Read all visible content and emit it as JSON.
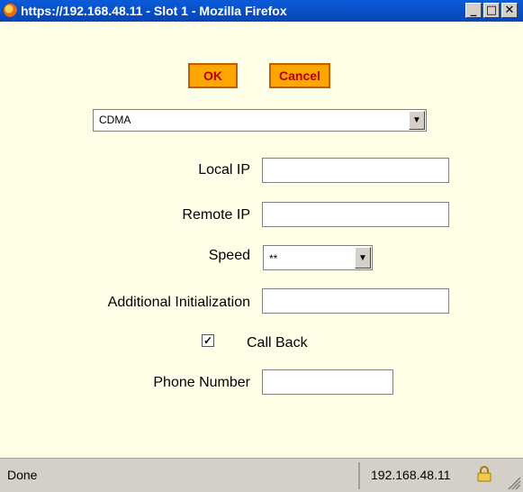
{
  "window": {
    "title": "https://192.168.48.11 - Slot 1 - Mozilla Firefox",
    "minimize": "_",
    "maximize": "□",
    "close": "✕"
  },
  "form": {
    "ok_label": "OK",
    "cancel_label": "Cancel",
    "modem_type": {
      "selected": "CDMA"
    },
    "local_ip": {
      "label": "Local IP",
      "value": ""
    },
    "remote_ip": {
      "label": "Remote IP",
      "value": ""
    },
    "speed": {
      "label": "Speed",
      "selected": "**"
    },
    "additional_init": {
      "label": "Additional Initialization",
      "value": ""
    },
    "call_back": {
      "label": "Call Back",
      "checked": true,
      "mark": "✓"
    },
    "phone_number": {
      "label": "Phone Number",
      "value": ""
    }
  },
  "status": {
    "text": "Done",
    "ip": "192.168.48.11"
  },
  "colors": {
    "button_fill": "#ffa600",
    "button_text": "#b50000",
    "page_bg": "#ffffe8",
    "titlebar": "#0a5bd8"
  }
}
